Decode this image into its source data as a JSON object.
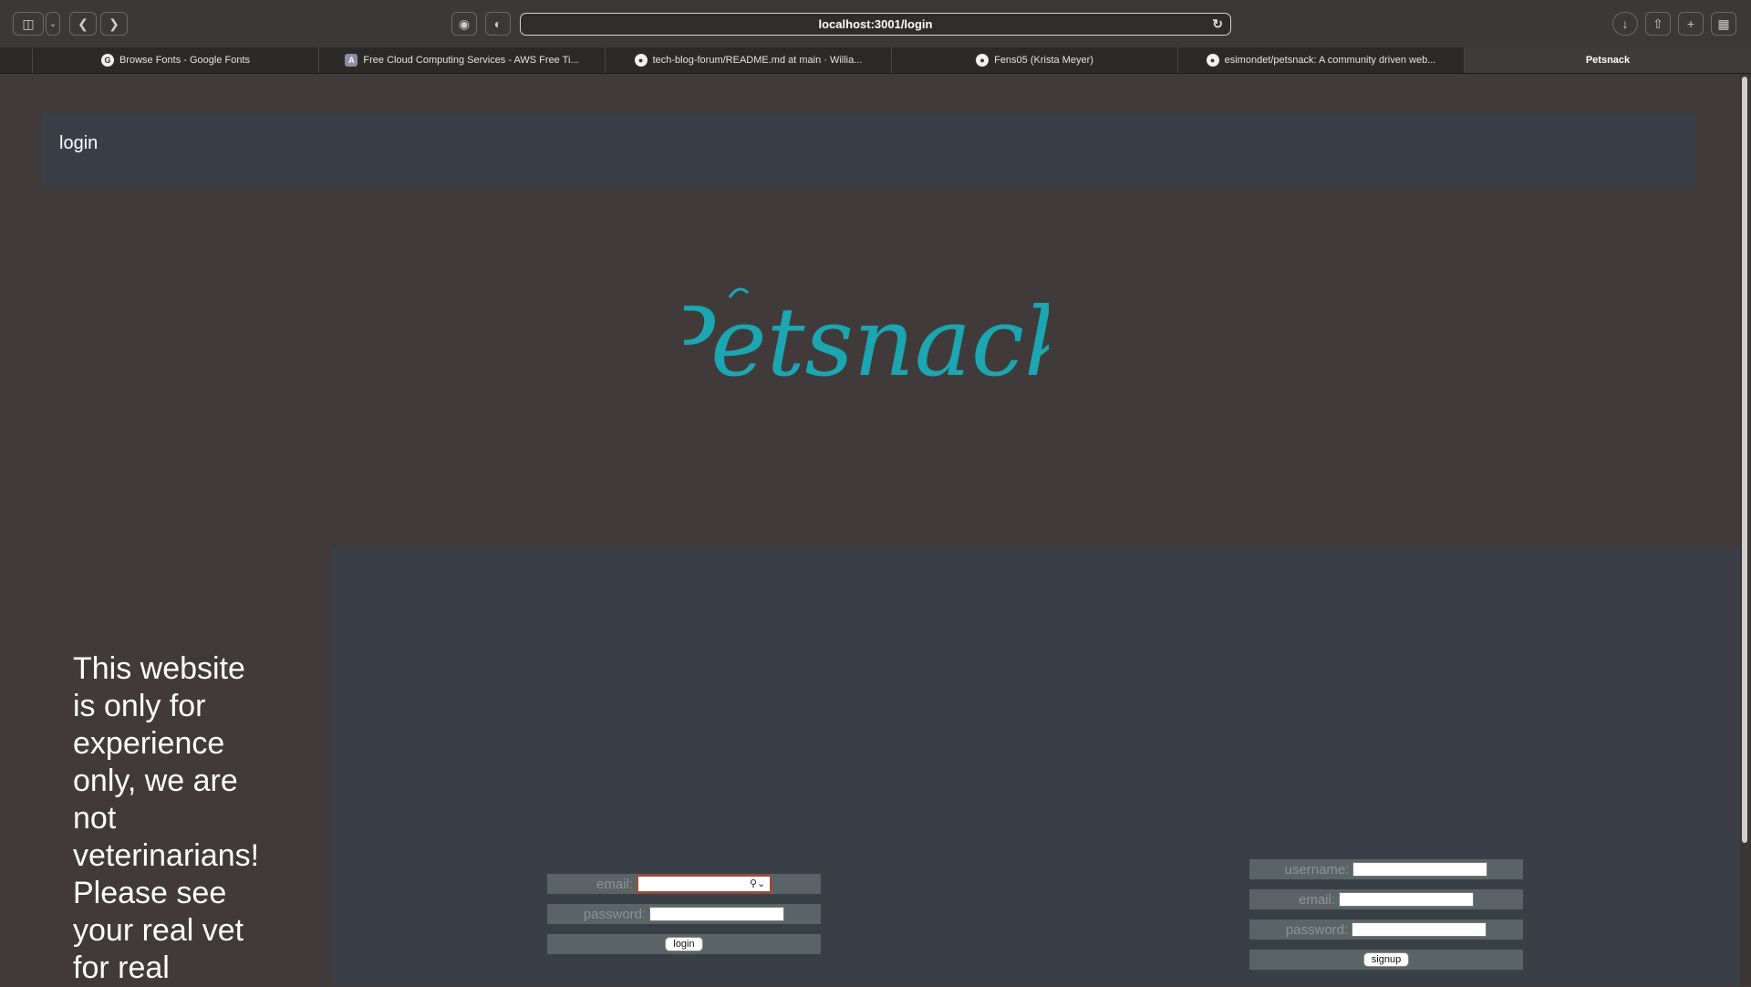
{
  "browser": {
    "url": "localhost:3001/login",
    "tabs": [
      {
        "label": "Browse Fonts - Google Fonts",
        "icon": "G"
      },
      {
        "label": "Free Cloud Computing Services - AWS Free Ti...",
        "icon": "A"
      },
      {
        "label": "tech-blog-forum/README.md at main · Willia...",
        "icon": "gh"
      },
      {
        "label": "Fens05 (Krista Meyer)",
        "icon": "gh"
      },
      {
        "label": "esimondet/petsnack: A community driven web...",
        "icon": "gh"
      },
      {
        "label": "Petsnack",
        "icon": ""
      }
    ]
  },
  "header": {
    "nav_link": "login"
  },
  "logo": {
    "text": "Petsnack",
    "color": "#1ba6b1"
  },
  "disclaimer": {
    "text": "This website is only for experience only, we are not veterinarians! Please see your real vet for real"
  },
  "login_form": {
    "email_label": "email:",
    "email_value": "",
    "password_label": "password:",
    "password_value": "",
    "submit_label": "login"
  },
  "signup_form": {
    "username_label": "username:",
    "username_value": "",
    "email_label": "email:",
    "email_value": "",
    "password_label": "password:",
    "password_value": "",
    "submit_label": "signup"
  }
}
